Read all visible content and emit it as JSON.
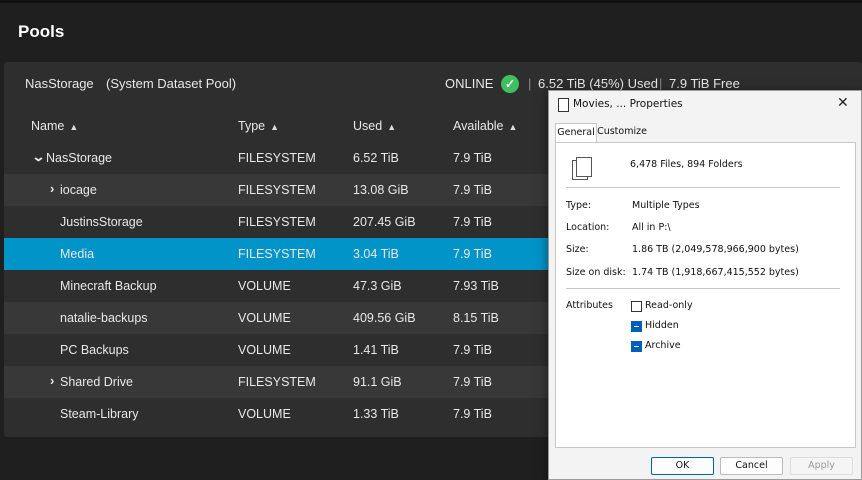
{
  "page": {
    "title": "Pools"
  },
  "pool": {
    "name": "NasStorage",
    "subtitle": "(System Dataset Pool)",
    "status": "ONLINE",
    "separator": "|",
    "used": "6.52 TiB (45%) Used",
    "free": "7.9 TiB Free"
  },
  "table": {
    "columns": [
      "Name",
      "Type",
      "Used",
      "Available"
    ],
    "rows": [
      {
        "name": "NasStorage",
        "type": "FILESYSTEM",
        "used": "6.52 TiB",
        "available": "7.9 TiB",
        "chevron": "v"
      },
      {
        "name": "iocage",
        "type": "FILESYSTEM",
        "used": "13.08 GiB",
        "available": "7.9 TiB",
        "chevron": ">"
      },
      {
        "name": "JustinsStorage",
        "type": "FILESYSTEM",
        "used": "207.45 GiB",
        "available": "7.9 TiB"
      },
      {
        "name": "Media",
        "type": "FILESYSTEM",
        "used": "3.04 TiB",
        "available": "7.9 TiB",
        "selected": true
      },
      {
        "name": "Minecraft Backup",
        "type": "VOLUME",
        "used": "47.3 GiB",
        "available": "7.93 TiB"
      },
      {
        "name": "natalie-backups",
        "type": "VOLUME",
        "used": "409.56 GiB",
        "available": "8.15 TiB"
      },
      {
        "name": "PC Backups",
        "type": "VOLUME",
        "used": "1.41 TiB",
        "available": "7.9 TiB"
      },
      {
        "name": "Shared Drive",
        "type": "FILESYSTEM",
        "used": "91.1 GiB",
        "available": "7.9 TiB",
        "chevron": ">"
      },
      {
        "name": "Steam-Library",
        "type": "VOLUME",
        "used": "1.33 TiB",
        "available": "7.9 TiB"
      }
    ]
  },
  "dialog": {
    "title": "Movies, ... Properties",
    "close": "✕",
    "tabs": [
      "General",
      "Customize"
    ],
    "summary": "6,478 Files, 894 Folders",
    "props": [
      {
        "label": "Type:",
        "value": "Multiple Types"
      },
      {
        "label": "Location:",
        "value": "All in P:\\"
      },
      {
        "label": "Size:",
        "value": "1.86 TB (2,049,578,966,900 bytes)"
      },
      {
        "label": "Size on disk:",
        "value": "1.74 TB (1,918,667,415,552 bytes)"
      }
    ],
    "attributes_label": "Attributes",
    "attributes": [
      {
        "label": "Read-only",
        "checked": false
      },
      {
        "label": "Hidden",
        "checked": true
      },
      {
        "label": "Archive",
        "checked": true
      }
    ],
    "buttons": {
      "ok": "OK",
      "cancel": "Cancel",
      "apply": "Apply"
    }
  },
  "colors": {
    "accent": "#0094c8",
    "status_ok": "#3fbf5f",
    "windows_blue": "#005fb8"
  },
  "icons": {
    "sort": "sort-icon",
    "status": "check-circle-icon",
    "file": "file-icon",
    "files": "multiple-files-icon",
    "close": "close-icon"
  }
}
